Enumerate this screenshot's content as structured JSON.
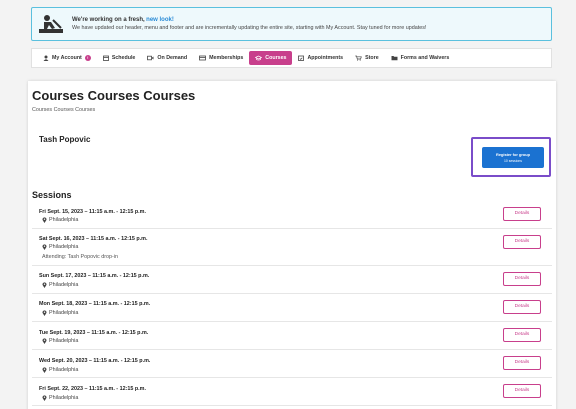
{
  "banner": {
    "title": "We're working on a fresh,",
    "link": "new look!",
    "text": "We have updated our header, menu and footer and are incrementally updating the entire site, starting with My Account. Stay tuned for more updates!"
  },
  "nav": {
    "items": [
      {
        "label": "My Account",
        "icon": "user-icon",
        "badge": "!"
      },
      {
        "label": "Schedule",
        "icon": "calendar-icon"
      },
      {
        "label": "On Demand",
        "icon": "video-icon"
      },
      {
        "label": "Memberships",
        "icon": "card-icon"
      },
      {
        "label": "Courses",
        "icon": "courses-icon",
        "active": true
      },
      {
        "label": "Appointments",
        "icon": "calendar-check-icon"
      },
      {
        "label": "Store",
        "icon": "cart-icon"
      },
      {
        "label": "Forms and Waivers",
        "icon": "folder-icon"
      }
    ]
  },
  "page": {
    "title": "Courses Courses Courses",
    "subtitle": "Courses Courses Courses",
    "instructor": "Tash Popovic"
  },
  "register": {
    "label": "Register for group",
    "sessions": "10 sessions"
  },
  "sessions": {
    "title": "Sessions",
    "details_label": "Details",
    "items": [
      {
        "date": "Fri Sept. 15, 2023 – 11:15 a.m. - 12:15 p.m.",
        "location": "Philadelphia"
      },
      {
        "date": "Sat Sept. 16, 2023 – 11:15 a.m. - 12:15 p.m.",
        "location": "Philadelphia",
        "extra": "Attending: Tash Popovic drop-in"
      },
      {
        "date": "Sun Sept. 17, 2023 – 11:15 a.m. - 12:15 p.m.",
        "location": "Philadelphia"
      },
      {
        "date": "Mon Sept. 18, 2023 – 11:15 a.m. - 12:15 p.m.",
        "location": "Philadelphia"
      },
      {
        "date": "Tue Sept. 19, 2023 – 11:15 a.m. - 12:15 p.m.",
        "location": "Philadelphia"
      },
      {
        "date": "Wed Sept. 20, 2023 – 11:15 a.m. - 12:15 p.m.",
        "location": "Philadelphia"
      },
      {
        "date": "Fri Sept. 22, 2023 – 11:15 a.m. - 12:15 p.m.",
        "location": "Philadelphia"
      }
    ]
  },
  "colors": {
    "accent": "#c83f8c",
    "primary_button": "#1b72d1",
    "banner_border": "#5bc0de",
    "highlight_frame": "#7a4cc9"
  }
}
